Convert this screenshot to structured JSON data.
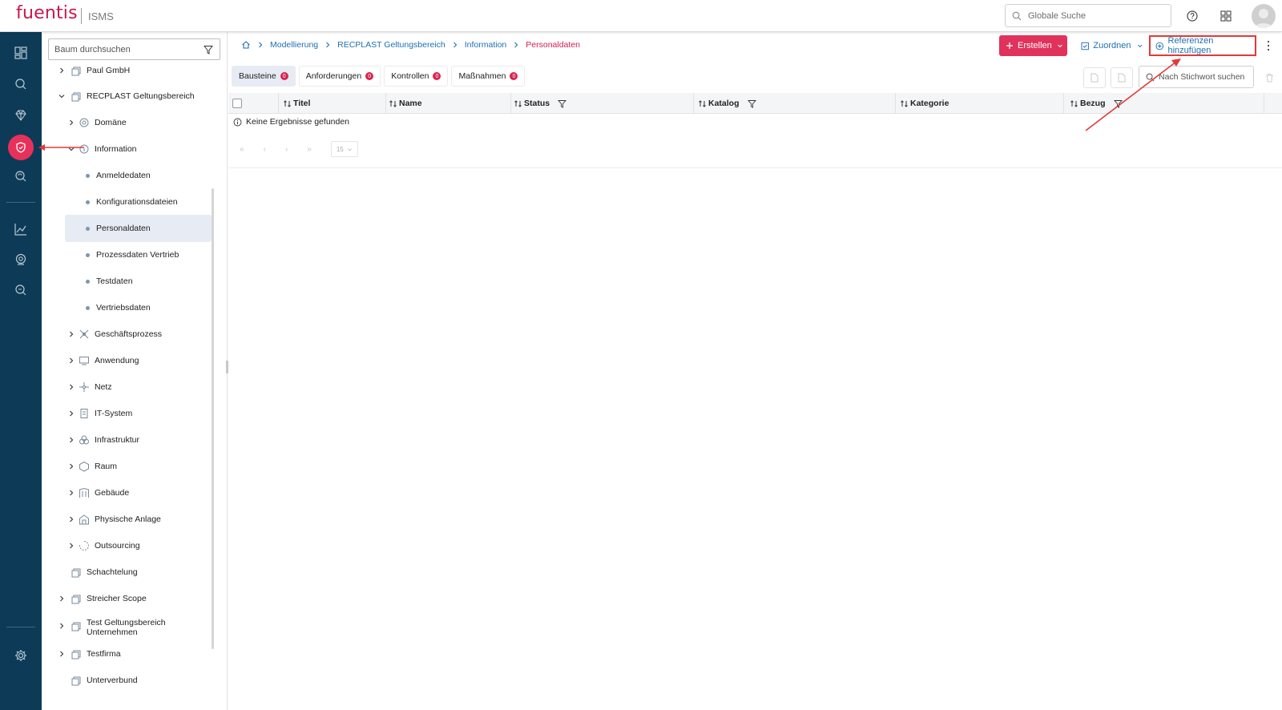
{
  "app": {
    "logo": "fuentis",
    "product": "ISMS"
  },
  "header": {
    "global_search_placeholder": "Globale Suche",
    "help_icon": "help-circle-icon",
    "apps_icon": "grid-icon"
  },
  "sidebar": {
    "icons": [
      "dashboard-icon",
      "search-icon",
      "diamond-icon",
      "shield-icon",
      "refresh-search-icon",
      "chart-icon",
      "monitor-icon",
      "audit-search-icon",
      "settings-icon"
    ],
    "active": "shield-icon",
    "active_color": "#e8315a",
    "bg_color": "#0d3b57"
  },
  "tree": {
    "search_placeholder": "Baum durchsuchen",
    "items": [
      {
        "label": "Paul GmbH",
        "level": 0,
        "expander": "collapsed",
        "icon": "scope-icon"
      },
      {
        "label": "RECPLAST Geltungsbereich",
        "level": 0,
        "expander": "expanded",
        "icon": "scope-icon"
      },
      {
        "label": "Domäne",
        "level": 1,
        "expander": "collapsed",
        "icon": "domain-icon"
      },
      {
        "label": "Information",
        "level": 1,
        "expander": "expanded",
        "icon": "information-icon"
      },
      {
        "label": "Anmeldedaten",
        "level": 2,
        "expander": "none",
        "icon": "dot"
      },
      {
        "label": "Konfigurationsdateien",
        "level": 2,
        "expander": "none",
        "icon": "dot"
      },
      {
        "label": "Personaldaten",
        "level": 2,
        "expander": "none",
        "icon": "dot",
        "selected": true
      },
      {
        "label": "Prozessdaten Vertrieb",
        "level": 2,
        "expander": "none",
        "icon": "dot"
      },
      {
        "label": "Testdaten",
        "level": 2,
        "expander": "none",
        "icon": "dot"
      },
      {
        "label": "Vertriebsdaten",
        "level": 2,
        "expander": "none",
        "icon": "dot"
      },
      {
        "label": "Geschäftsprozess",
        "level": 1,
        "expander": "collapsed",
        "icon": "process-icon"
      },
      {
        "label": "Anwendung",
        "level": 1,
        "expander": "collapsed",
        "icon": "application-icon"
      },
      {
        "label": "Netz",
        "level": 1,
        "expander": "collapsed",
        "icon": "network-icon"
      },
      {
        "label": "IT-System",
        "level": 1,
        "expander": "collapsed",
        "icon": "server-icon"
      },
      {
        "label": "Infrastruktur",
        "level": 1,
        "expander": "collapsed",
        "icon": "infrastructure-icon"
      },
      {
        "label": "Raum",
        "level": 1,
        "expander": "collapsed",
        "icon": "room-icon"
      },
      {
        "label": "Gebäude",
        "level": 1,
        "expander": "collapsed",
        "icon": "building-icon"
      },
      {
        "label": "Physische Anlage",
        "level": 1,
        "expander": "collapsed",
        "icon": "facility-icon"
      },
      {
        "label": "Outsourcing",
        "level": 1,
        "expander": "collapsed",
        "icon": "outsourcing-icon"
      },
      {
        "label": "Schachtelung",
        "level": 0,
        "expander": "none",
        "icon": "scope-icon"
      },
      {
        "label": "Streicher Scope",
        "level": 0,
        "expander": "collapsed",
        "icon": "scope-icon"
      },
      {
        "label": "Test Geltungsbereich Unternehmen",
        "level": 0,
        "expander": "collapsed",
        "icon": "scope-icon"
      },
      {
        "label": "Testfirma",
        "level": 0,
        "expander": "collapsed",
        "icon": "scope-icon"
      },
      {
        "label": "Unterverbund",
        "level": 0,
        "expander": "none",
        "icon": "scope-icon"
      }
    ]
  },
  "breadcrumb": [
    "Modellierung",
    "RECPLAST Geltungsbereich",
    "Information",
    "Personaldaten"
  ],
  "toolbar": {
    "create_label": "Erstellen",
    "assign_label": "Zuordnen",
    "add_references_label": "Referenzen hinzufügen",
    "keyword_search_placeholder": "Nach Stichwort suchen"
  },
  "tabs": [
    {
      "label": "Bausteine",
      "count": "0",
      "active": true
    },
    {
      "label": "Anforderungen",
      "count": "0"
    },
    {
      "label": "Kontrollen",
      "count": "0"
    },
    {
      "label": "Maßnahmen",
      "count": "0"
    }
  ],
  "table": {
    "columns": [
      {
        "label": "Titel",
        "filter": false
      },
      {
        "label": "Name",
        "filter": false
      },
      {
        "label": "Status",
        "filter": true
      },
      {
        "label": "Katalog",
        "filter": true
      },
      {
        "label": "Kategorie",
        "filter": false
      },
      {
        "label": "Bezug",
        "filter": true
      }
    ],
    "empty_message": "Keine Ergebnisse gefunden",
    "pager": {
      "first": "«",
      "prev": "‹",
      "next": "›",
      "last": "»",
      "page_size": "15"
    }
  },
  "colors": {
    "brand": "#c8174b",
    "primary_button": "#e0325a",
    "link": "#1f6fb2",
    "annotation": "#e23a3a"
  }
}
